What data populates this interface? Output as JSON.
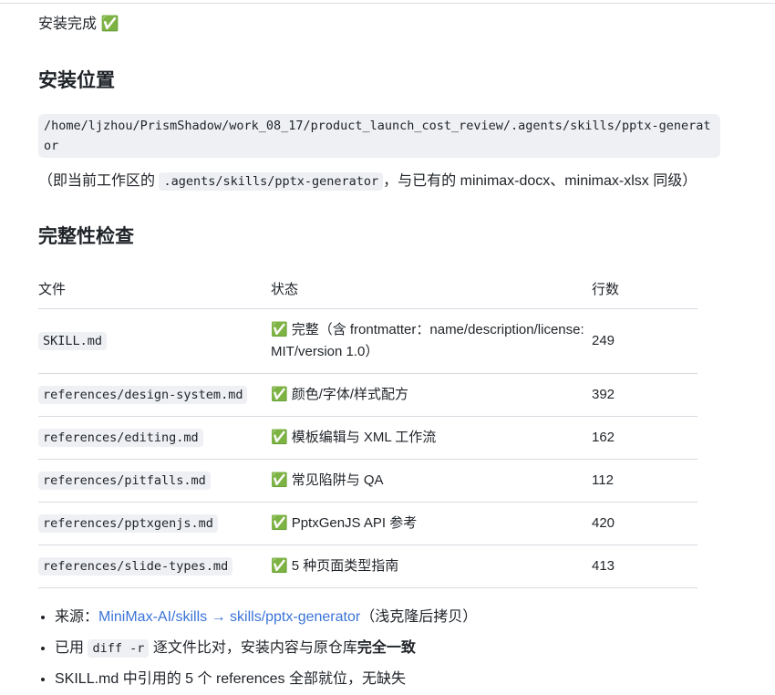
{
  "intro": {
    "text": "安装完成",
    "check": "✅"
  },
  "location": {
    "heading": "安装位置",
    "path": "/home/ljzhou/PrismShadow/work_08_17/product_launch_cost_review/.agents/skills/pptx-generator",
    "note_prefix": "（即当前工作区的",
    "note_code": ".agents/skills/pptx-generator",
    "note_suffix": "，与已有的 minimax-docx、minimax-xlsx 同级）"
  },
  "check": {
    "heading": "完整性检查",
    "columns": [
      "文件",
      "状态",
      "行数"
    ],
    "rows": [
      {
        "file": "SKILL.md",
        "status": "完整（含 frontmatter：name/description/license: MIT/version 1.0）",
        "lines": "249"
      },
      {
        "file": "references/design-system.md",
        "status": "颜色/字体/样式配方",
        "lines": "392"
      },
      {
        "file": "references/editing.md",
        "status": "模板编辑与 XML 工作流",
        "lines": "162"
      },
      {
        "file": "references/pitfalls.md",
        "status": "常见陷阱与 QA",
        "lines": "112"
      },
      {
        "file": "references/pptxgenjs.md",
        "status": "PptxGenJS API 参考",
        "lines": "420"
      },
      {
        "file": "references/slide-types.md",
        "status": "5 种页面类型指南",
        "lines": "413"
      }
    ],
    "status_icon": "✅"
  },
  "bullets": {
    "source_label": "来源：",
    "source_link": "MiniMax-AI/skills → skills/pptx-generator",
    "source_suffix": "（浅克隆后拷贝）",
    "diff_prefix": "已用",
    "diff_code": "diff -r",
    "diff_mid": "逐文件比对，安装内容与原仓库",
    "diff_bold": "完全一致",
    "refs_text": "SKILL.md 中引用的 5 个 references 全部就位，无缺失"
  }
}
